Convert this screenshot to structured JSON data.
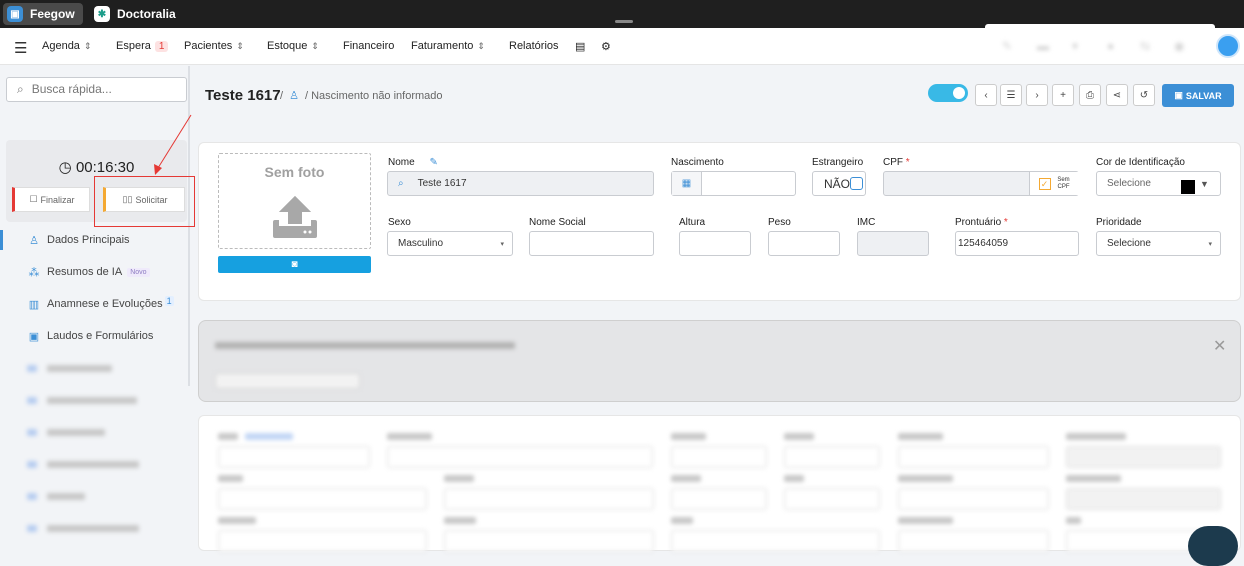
{
  "topbar": {
    "tabs": [
      {
        "label": "Feegow",
        "logo": "feegow-logo"
      },
      {
        "label": "Doctoralia",
        "logo": "doctoralia-logo"
      }
    ]
  },
  "nav": {
    "items": [
      {
        "label": "Agenda",
        "caret": "⌃"
      },
      {
        "label": "Espera",
        "badge": "1"
      },
      {
        "label": "Pacientes",
        "caret": "⌃"
      },
      {
        "label": "Estoque",
        "caret": "⌃"
      },
      {
        "label": "Financeiro"
      },
      {
        "label": "Faturamento",
        "caret": "⌃"
      },
      {
        "label": "Relatórios"
      }
    ]
  },
  "sidebar": {
    "search_placeholder": "Busca rápida...",
    "timer": "00:16:30",
    "finalizar": "Finalizar",
    "solicitar": "Solicitar",
    "menu": [
      {
        "label": "Dados Principais",
        "icon": "user-icon"
      },
      {
        "label": "Resumos de IA",
        "icon": "ai-icon",
        "tag": "Novo"
      },
      {
        "label": "Anamnese e Evoluções",
        "icon": "chart-icon",
        "count": "1"
      },
      {
        "label": "Laudos e Formulários",
        "icon": "clipboard-icon"
      }
    ]
  },
  "header": {
    "patient_name": "Teste 1617",
    "birth": "Nascimento não informado",
    "save_label": "SALVAR"
  },
  "form": {
    "no_photo": "Sem foto",
    "nome_label": "Nome",
    "nome_value": "Teste 1617",
    "nascimento_label": "Nascimento",
    "estrangeiro_label": "Estrangeiro",
    "estrangeiro_value": "NÃO",
    "cpf_label": "CPF",
    "sem_cpf": "Sem CPF",
    "cor_label": "Cor de Identificação",
    "cor_value": "Selecione",
    "sexo_label": "Sexo",
    "sexo_value": "Masculino",
    "nome_social_label": "Nome Social",
    "altura_label": "Altura",
    "peso_label": "Peso",
    "imc_label": "IMC",
    "prontuario_label": "Prontuário",
    "prontuario_value": "125464059",
    "prioridade_label": "Prioridade",
    "prioridade_value": "Selecione"
  },
  "colors": {
    "accent": "#3c8fd6",
    "toggle": "#39b9e6",
    "camera": "#16a0e0",
    "highlight": "#e53935"
  }
}
